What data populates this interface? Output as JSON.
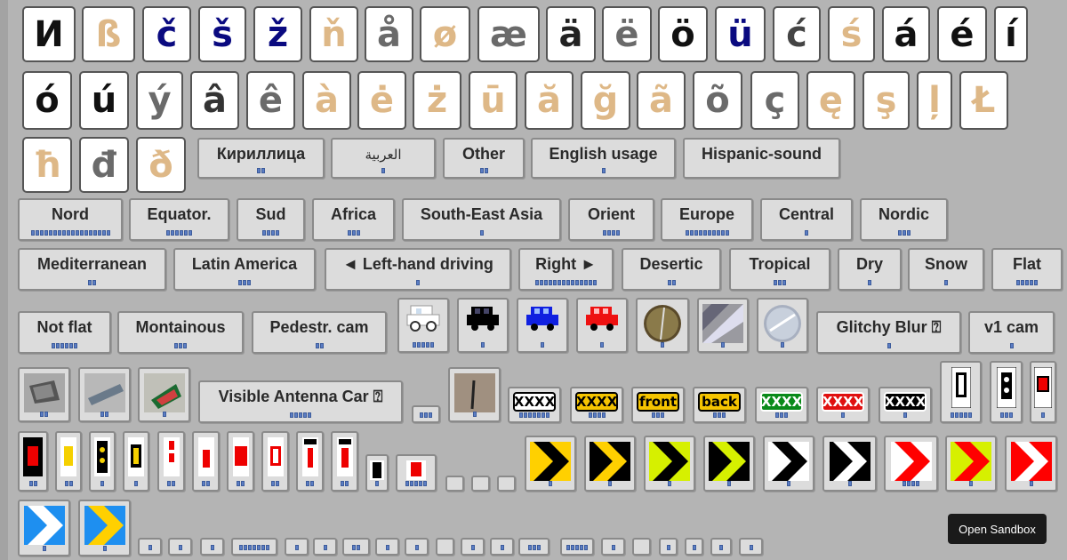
{
  "letters": [
    {
      "ch": "И",
      "color": "#111111"
    },
    {
      "ch": "ß",
      "color": "#deb887"
    },
    {
      "ch": "č",
      "color": "#0a0a80"
    },
    {
      "ch": "š",
      "color": "#0a0a80"
    },
    {
      "ch": "ž",
      "color": "#0a0a80"
    },
    {
      "ch": "ň",
      "color": "#deb887"
    },
    {
      "ch": "å",
      "color": "#6a6a6a"
    },
    {
      "ch": "ø",
      "color": "#deb887"
    },
    {
      "ch": "æ",
      "color": "#6a6a6a"
    },
    {
      "ch": "ä",
      "color": "#222222"
    },
    {
      "ch": "ë",
      "color": "#6a6a6a"
    },
    {
      "ch": "ö",
      "color": "#111111"
    },
    {
      "ch": "ü",
      "color": "#0a0a80"
    },
    {
      "ch": "ć",
      "color": "#444444"
    },
    {
      "ch": "ś",
      "color": "#deb887"
    },
    {
      "ch": "á",
      "color": "#111111"
    },
    {
      "ch": "é",
      "color": "#111111"
    },
    {
      "ch": "í",
      "color": "#111111"
    },
    {
      "ch": "ó",
      "color": "#111111"
    },
    {
      "ch": "ú",
      "color": "#111111"
    },
    {
      "ch": "ý",
      "color": "#6a6a6a"
    },
    {
      "ch": "â",
      "color": "#333333"
    },
    {
      "ch": "ê",
      "color": "#6a6a6a"
    },
    {
      "ch": "à",
      "color": "#deb887"
    },
    {
      "ch": "ė",
      "color": "#deb887"
    },
    {
      "ch": "ż",
      "color": "#deb887"
    },
    {
      "ch": "ū",
      "color": "#deb887"
    },
    {
      "ch": "ă",
      "color": "#deb887"
    },
    {
      "ch": "ğ",
      "color": "#deb887"
    },
    {
      "ch": "ã",
      "color": "#deb887"
    },
    {
      "ch": "õ",
      "color": "#6a6a6a"
    },
    {
      "ch": "ç",
      "color": "#6a6a6a"
    },
    {
      "ch": "ę",
      "color": "#deb887"
    },
    {
      "ch": "ş",
      "color": "#deb887"
    },
    {
      "ch": "ļ",
      "color": "#deb887"
    },
    {
      "ch": "Ł",
      "color": "#deb887"
    },
    {
      "ch": "ħ",
      "color": "#deb887"
    },
    {
      "ch": "đ",
      "color": "#6a6a6a"
    },
    {
      "ch": "ð",
      "color": "#deb887"
    }
  ],
  "buttons": {
    "cyrillic": "Кириллица",
    "arabic": "العربية",
    "other": "Other",
    "english_usage": "English usage",
    "hispanic_sound": "Hispanic-sound",
    "nord": "Nord",
    "equator": "Equator.",
    "sud": "Sud",
    "africa": "Africa",
    "se_asia": "South-East Asia",
    "orient": "Orient",
    "europe": "Europe",
    "central": "Central",
    "nordic": "Nordic",
    "mediterranean": "Mediterranean",
    "latin_america": "Latin America",
    "left_hand": "◄ Left-hand driving",
    "right": "Right ►",
    "desertic": "Desertic",
    "tropical": "Tropical",
    "dry": "Dry",
    "snow": "Snow",
    "flat": "Flat",
    "not_flat": "Not flat",
    "montainous": "Montainous",
    "pedestr_cam": "Pedestr. cam",
    "glitchy_blur": "Glitchy Blur ⍰",
    "v1_cam": "v1 cam",
    "visible_antenna": "Visible Antenna Car ⍰"
  },
  "plates": {
    "p1": "XXXX",
    "p2": "XXXX",
    "front": "front",
    "back": "back",
    "p5": "XXXX",
    "p6": "XXXX",
    "p7": "XXXX"
  },
  "icons": [
    "white-car-icon",
    "black-car-icon",
    "blue-car-icon",
    "red-car-icon",
    "dirt-blur-icon",
    "silver-blur-icon",
    "glass-blur-icon",
    "car-mirror-icon",
    "car-roof-icon",
    "green-mirror-icon",
    "antenna-icon",
    "bollard-icon",
    "chevron-icon"
  ],
  "colors": {
    "background": "#b4b4b4",
    "button": "#dcdcdc",
    "bar": "#5b7dc4",
    "chevron_yellow": "#ffd000",
    "chevron_lime": "#d6f000",
    "chevron_red": "#ff0000",
    "chevron_blue": "#1e8ff0"
  },
  "sandbox_label": "Open Sandbox"
}
